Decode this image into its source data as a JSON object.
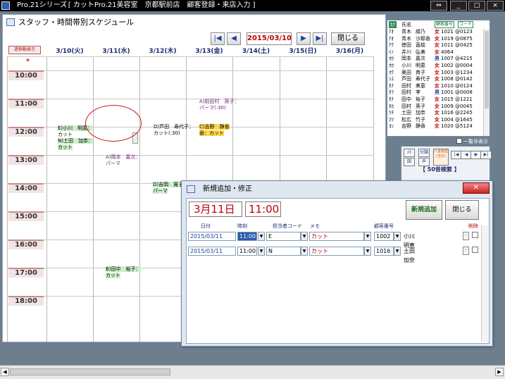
{
  "titlebar": {
    "app": "Pro.21シリーズ",
    "title": "- [ カットPro.21美容室　京都駅前店　顧客登録・来店入力 ]",
    "buttons": [
      "⇔",
      "_",
      "□",
      "×"
    ]
  },
  "schedule": {
    "title": "スタッフ・時間帯別スケジュール",
    "nav": {
      "first": "|◀",
      "prev": "◀",
      "date": "2015/03/10",
      "next": "▶",
      "last": "▶|",
      "close": "閉じる"
    },
    "header_button": "週移動表示",
    "days": [
      "3/10(火)",
      "3/11(水)",
      "3/12(木)",
      "3/13(金)",
      "3/14(土)",
      "3/15(日)",
      "3/16(月)"
    ],
    "times": [
      "10:00",
      "11:00",
      "12:00",
      "13:00",
      "14:00",
      "15:00",
      "16:00",
      "17:00",
      "18:00"
    ],
    "star": "*",
    "appointments": [
      {
        "day": 1,
        "lines": [
          {
            "t": "E)小川　明恵：",
            "c": "g"
          },
          {
            "t": "カット",
            "c": "n"
          },
          {
            "t": "N)土田　加奈：",
            "c": "g"
          },
          {
            "t": "カット",
            "c": "g"
          }
        ]
      },
      {
        "day": 3,
        "lines": [
          {
            "t": "D)芦田　寿代子：",
            "c": "n"
          },
          {
            "t": "カット(:30)",
            "c": "n"
          }
        ]
      },
      {
        "day": 4,
        "lines": [
          {
            "t": "C)吉野　静香",
            "c": "y"
          },
          {
            "t": "香：カット",
            "c": "y"
          }
        ]
      },
      {
        "day": 4,
        "lines": [
          {
            "t": "A)前田村　英子：",
            "c": "p"
          },
          {
            "t": "パーマ(:30)",
            "c": "p"
          }
        ]
      },
      {
        "day": 2,
        "lines": [
          {
            "t": "A)岡本　嘉次：",
            "c": "p"
          },
          {
            "t": "パーマ",
            "c": "p"
          }
        ]
      },
      {
        "day": 3,
        "lines": [
          {
            "t": "D)吉岡　寛子：",
            "c": "g"
          },
          {
            "t": "パーマ",
            "c": "g"
          }
        ]
      },
      {
        "day": 2,
        "lines": [
          {
            "t": "B)田中　裕子：",
            "c": "g"
          },
          {
            "t": "カット",
            "c": "g"
          }
        ]
      }
    ]
  },
  "customers": {
    "headers": {
      "kana": "ｶﾅ",
      "name": "氏名",
      "no": "顧客番号",
      "code": "コード"
    },
    "rows": [
      {
        "k": "ｱｵ",
        "n1": "青木",
        "n2": "緑乃",
        "s": "女",
        "no": "1021",
        "ph": "@0123"
      },
      {
        "k": "ｱｵ",
        "n1": "青木",
        "n2": "沙耶香",
        "s": "女",
        "no": "1019",
        "ph": "@0875"
      },
      {
        "k": "ｱｸ",
        "n1": "徳田",
        "n2": "直絵",
        "s": "女",
        "no": "1011",
        "ph": "@0425"
      },
      {
        "k": "ｲﾉ",
        "n1": "井川",
        "n2": "弘美",
        "s": "女",
        "no": "4064",
        "ph": ""
      },
      {
        "k": "ｵｶ",
        "n1": "岡本",
        "n2": "嘉次",
        "s": "男",
        "no": "1007",
        "ph": "@4215"
      },
      {
        "k": "ｵｶ",
        "n1": "小川",
        "n2": "明恵",
        "s": "女",
        "no": "1002",
        "ph": "@0004"
      },
      {
        "k": "ｵｸ",
        "n1": "奥田",
        "n2": "育子",
        "s": "女",
        "no": "1003",
        "ph": "@1234"
      },
      {
        "k": "ｼﾕ",
        "n1": "芦田",
        "n2": "寿代子",
        "s": "女",
        "no": "1008",
        "ph": "@0142"
      },
      {
        "k": "ﾀﾅ",
        "n1": "田村",
        "n2": "美恵",
        "s": "女",
        "no": "1010",
        "ph": "@0124"
      },
      {
        "k": "ﾀﾗ",
        "n1": "田村",
        "n2": "李",
        "s": "男",
        "no": "1001",
        "ph": "@0008"
      },
      {
        "k": "ﾀﾅ",
        "n1": "田中",
        "n2": "裕子",
        "s": "女",
        "no": "1015",
        "ph": "@1221"
      },
      {
        "k": "ﾀｶ",
        "n1": "田村",
        "n2": "英子",
        "s": "女",
        "no": "1009",
        "ph": "@0045"
      },
      {
        "k": "ﾂﾁ",
        "n1": "土田",
        "n2": "加奈",
        "s": "女",
        "no": "1016",
        "ph": "@2245"
      },
      {
        "k": "ﾏﾂ",
        "n1": "松広",
        "n2": "竹子",
        "s": "女",
        "no": "1004",
        "ph": "@1645"
      },
      {
        "k": "ﾖｼ",
        "n1": "吉野",
        "n2": "静香",
        "s": "女",
        "no": "1020",
        "ph": "@5124"
      }
    ],
    "list_hide": "一覧非表示",
    "small_buttons": [
      "ﾒﾓ",
      "分類",
      "図",
      "声",
      "入金履歴\n(当日)"
    ],
    "nav_buttons": [
      "|◀",
      "◀",
      "▶",
      "▶|"
    ],
    "search": "【 50音検索 】"
  },
  "dialog": {
    "title": "新規追加・修正",
    "close_x": "✕",
    "date": "3月11日",
    "time": "11:00",
    "new_btn": "新規追加",
    "close_btn": "閉じる",
    "columns": {
      "date": "日付",
      "time": "時刻",
      "staff": "担当者コード",
      "memo": "メモ",
      "custno": "顧客番号",
      "delete": "削除"
    },
    "rows": [
      {
        "date": "2015/03/11",
        "time": "11:00",
        "staff": "E",
        "memo": "カット",
        "custno": "1002",
        "name": "小川　明恵"
      },
      {
        "date": "2015/03/11",
        "time": "11:00",
        "staff": "N",
        "memo": "カット",
        "custno": "1016",
        "name": "土田　加奈"
      }
    ]
  },
  "colors": {
    "accent": "#c00000",
    "navy": "#1f2b6b",
    "highlight": "#2a5aaa"
  }
}
